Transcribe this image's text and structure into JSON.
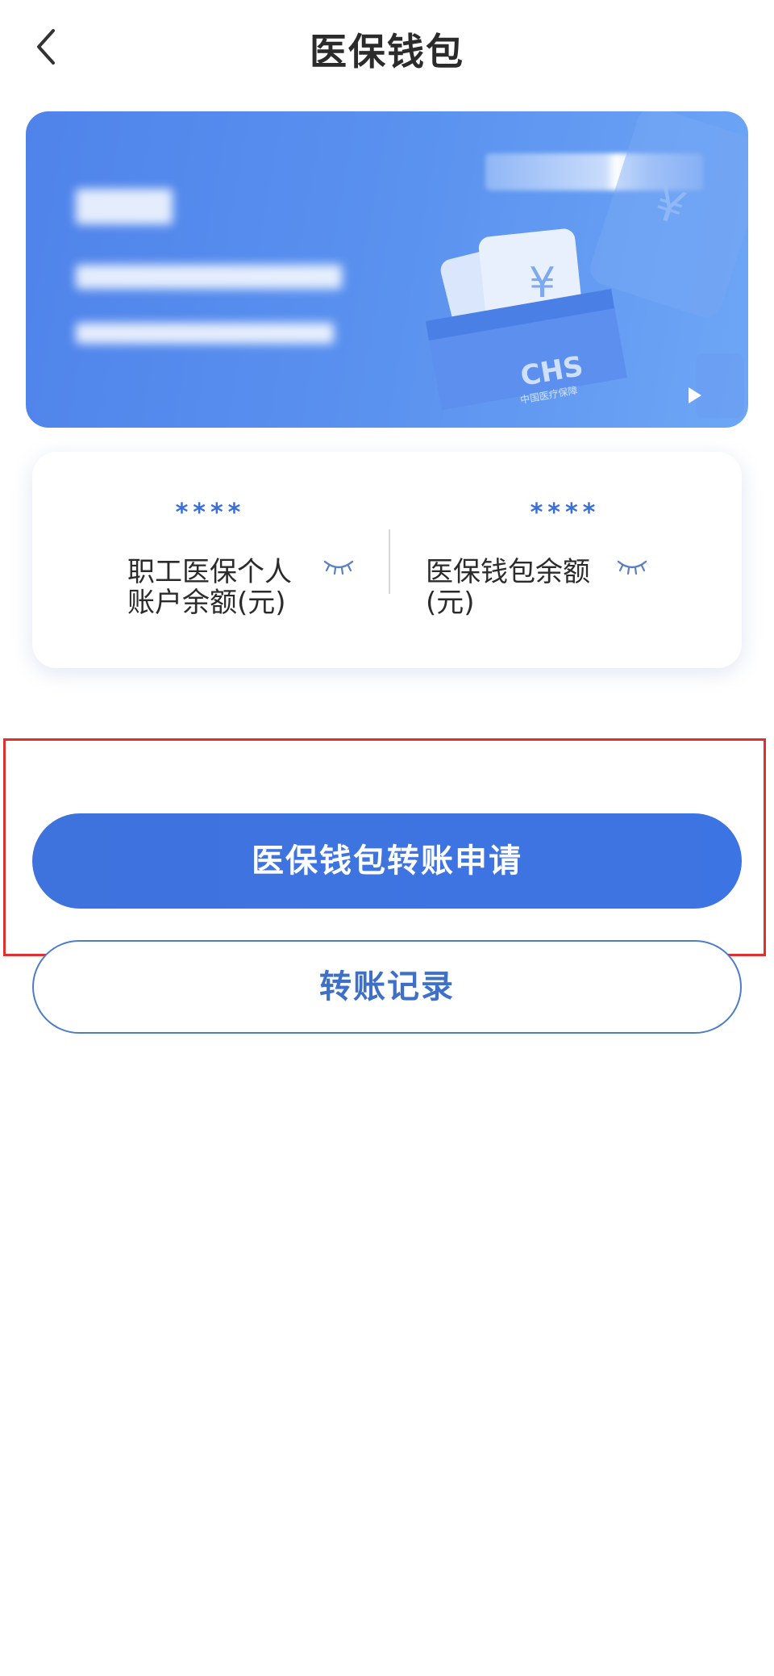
{
  "header": {
    "title": "医保钱包"
  },
  "card": {
    "logo_text": "CHS",
    "logo_subtext": "中国医疗保障"
  },
  "balances": [
    {
      "masked_value": "****",
      "label": "职工医保个人账户余额(元)"
    },
    {
      "masked_value": "****",
      "label": "医保钱包余额(元)"
    }
  ],
  "actions": {
    "transfer_apply_label": "医保钱包转账申请",
    "transfer_records_label": "转账记录"
  },
  "colors": {
    "primary": "#3d74e3",
    "highlight_border": "#e0302c"
  },
  "icons": {
    "back": "chevron-left-icon",
    "hide": "eye-closed-icon",
    "play": "play-icon"
  }
}
